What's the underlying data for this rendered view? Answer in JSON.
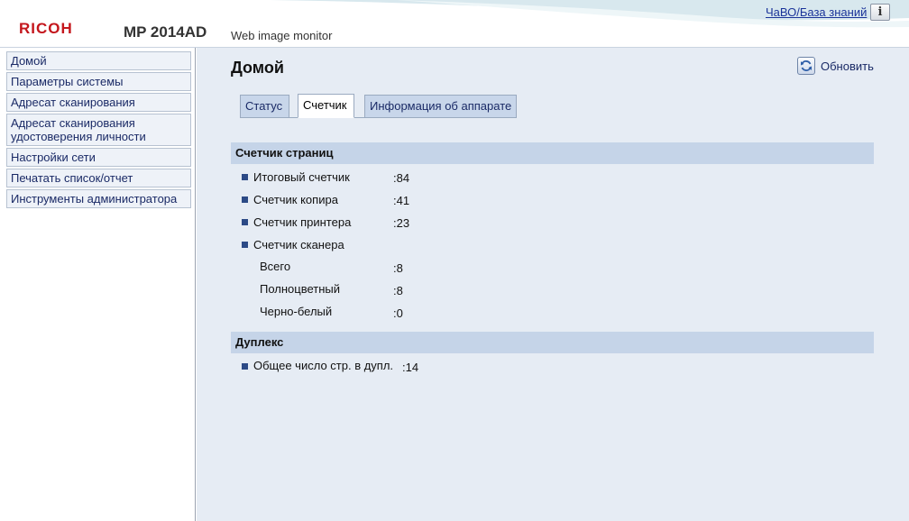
{
  "header": {
    "brand": "RICOH",
    "model": "MP 2014AD",
    "app_name": "Web image monitor",
    "faq_link": "ЧаВО/База знаний",
    "info_icon": "info-icon",
    "info_glyph": "i"
  },
  "sidebar": {
    "items": [
      {
        "label": "Домой"
      },
      {
        "label": "Параметры системы"
      },
      {
        "label": "Адресат сканирования"
      },
      {
        "label": "Адресат сканирования удостоверения личности"
      },
      {
        "label": "Настройки сети"
      },
      {
        "label": "Печатать список/отчет"
      },
      {
        "label": "Инструменты администратора"
      }
    ]
  },
  "main": {
    "title": "Домой",
    "refresh_label": "Обновить",
    "tabs": [
      {
        "label": "Статус",
        "active": false
      },
      {
        "label": "Счетчик",
        "active": true
      },
      {
        "label": "Информация об аппарате",
        "active": false
      }
    ],
    "page_counter": {
      "heading": "Счетчик страниц",
      "rows": [
        {
          "label": "Итоговый счетчик",
          "value": ":84"
        },
        {
          "label": "Счетчик копира",
          "value": ":41"
        },
        {
          "label": "Счетчик принтера",
          "value": ":23"
        },
        {
          "label": "Счетчик сканера",
          "value": ""
        }
      ],
      "scanner_sub": [
        {
          "label": "Всего",
          "value": ":8"
        },
        {
          "label": "Полноцветный",
          "value": ":8"
        },
        {
          "label": "Черно-белый",
          "value": ":0"
        }
      ]
    },
    "duplex": {
      "heading": "Дуплекс",
      "rows": [
        {
          "label": "Общее число стр. в дупл.",
          "value": ":14"
        }
      ]
    }
  },
  "colors": {
    "brand_red": "#c4161c",
    "link_blue": "#1a3399",
    "section_bar": "#c5d4e8",
    "main_bg": "#e6ecf4"
  }
}
